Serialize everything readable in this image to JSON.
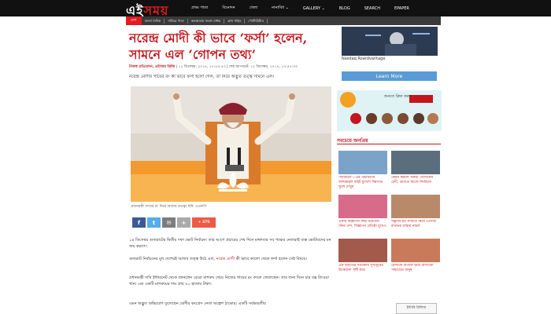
{
  "header": {
    "logo_left": "এই",
    "logo_right": "সময়",
    "nav": [
      "প্রথম পাতা",
      "বিনোদন",
      "খেলা",
      "নানাবিধ ⌄",
      "GALLERY ⌄",
      "BLOG",
      "SEARCH",
      "EPAPER"
    ]
  },
  "subnav": {
    "section": "দেশ",
    "items": [
      "বাংলা দৈনিক",
      "সর্বিতর পাতা",
      "কলকাতায় সংবাদ মাধ্যম",
      "ক্লাস গাইড",
      "পোস্টারিটাও"
    ]
  },
  "article": {
    "headline": "নরেন্দ্র মোদী কী ভাবে ‘ফর্সা’ হলেন, সামনে এল ‘গোপন তথ্য’",
    "author": "নিজস্ব প্রতিবেদন, এইসময় ডিজি",
    "dateline": "| ১২ ডিসেম্বর, ২০১৭, ১৭:৫৩:৫৩ | শেষ আপডেট: ১২ ডিসেম্বর, ২০১৭, ১৭:৫৭:৩৩",
    "dek": "নরেন্দ্র মোদীর গায়ের রং কী ভাবে ফর্সা হলো গেল, তা নিয়ে অদ্ভুত তত্ত্ব সামনে এল।",
    "caption": "প্রধানমন্ত্রী গায়ের রং নিয়ে আজব তত্ত্ব। ছবি: এএফপি",
    "share_count": "+ 375",
    "paragraphs": [
      "১৪ ডিসেম্বর গুজরাটের দ্বিতীয় দফা ভোট নির্বাচন। তার আগে প্রচারের শেষ দিনে মঙ্গলবার সব পক্ষের নেতারাই ব্যস্ত ভোটারদের মন জয় করতে।",
      "গুজরাট নির্বাচনের মুখ দেশেরই আজব তত্ত্ব উঠে এল, নরেন্দ্র মোদী কী ভাবে কালো থেকে ফর্সা হলেন সেই বিষয়ে।",
      "প্রধানমন্ত্রী দাবি ইন্টারনেট থেকে জানলেন বেরো মাশরুম খেয়ে নিজের গায়ের রং বদলে ফেলেছেন। তার জন্য দিনে চার বক্স ট্যাওয়া খান। এক একটি মাশরুমের দাম প্রায় ৮০ হাজার টাকা।",
      "এমন অদ্ভুত অভিযোগ তুলেছেন মোদীর কংগ্রেস নেতা অল্পেশ ঠাকোর। একটি সর্বভারতীয়"
    ],
    "link_text": "নরেন্দ্র মোদী"
  },
  "sidebar": {
    "ad_caption": "Nasdaq Roardvantage",
    "learn_more": "Learn More",
    "banner_label": "শুনতে ক্লিক করুন",
    "popular_heading": "সবচেয়ে জনপ্রিয়",
    "popular": [
      "'আবারো'—এর পদ্মাবতীর অন্দরমহল বাইট মুখোশ দিন্নপাত খুলে দেখুন",
      "কেমন করলে 'বর্ষাই' বেদোমেঘ চেদী, ভারতে কাজে নির্বাচনে",
      "একটি বিজ্ঞাপন বছর ভারতীয় সদ্দর দেশ, বিজ্ঞাপন প্রতিষ্ঠা মুখেও",
      "সন্তুবিব হয় সম্প্রতি নিয়ে এসেছে রাতভর রাস্তায় নাচল",
      "এক ছবিতেই সমর্থকার সুখজুরের উত্তেজনা সৃষ্টি করে",
      "মোদীকে বাতাবা দ্বারা বাণিজ্যে পঞ্চায়েত মানুষ"
    ],
    "widget_label": "ইন্টারি রিলিজ"
  }
}
